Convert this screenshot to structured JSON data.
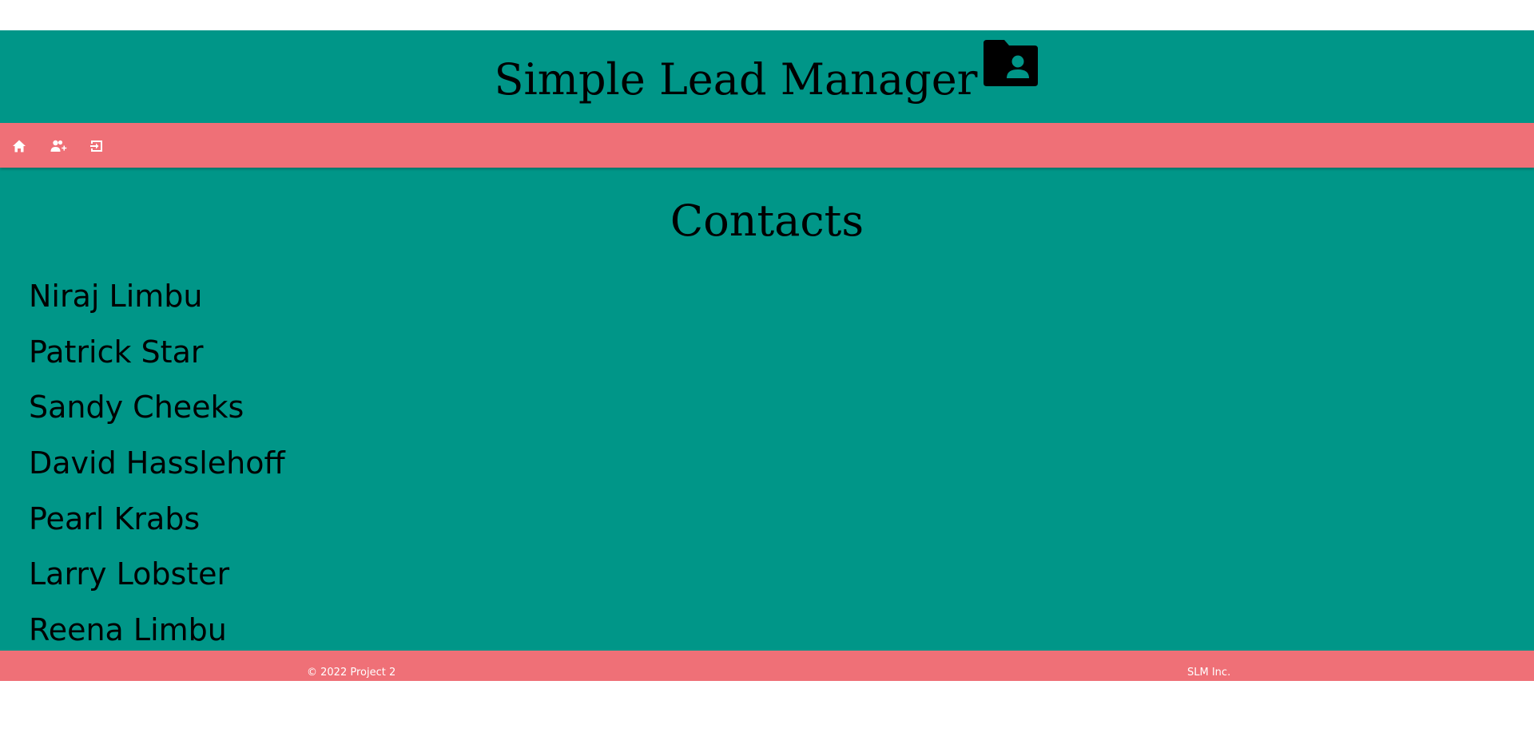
{
  "header": {
    "title": "Simple Lead Manager",
    "icon": "contact-folder-icon"
  },
  "nav": {
    "items": [
      {
        "icon": "home-icon"
      },
      {
        "icon": "add-user-icon"
      },
      {
        "icon": "logout-icon"
      }
    ]
  },
  "main": {
    "heading": "Contacts",
    "contacts": [
      "Niraj Limbu",
      "Patrick Star",
      "Sandy Cheeks",
      "David Hasslehoff",
      "Pearl Krabs",
      "Larry Lobster",
      "Reena Limbu"
    ]
  },
  "footer": {
    "copyright": "© 2022 Project 2",
    "company": "SLM Inc."
  },
  "colors": {
    "primary": "#009688",
    "accent": "#ef7077",
    "text": "#000000",
    "footer_text": "#ffffff"
  }
}
